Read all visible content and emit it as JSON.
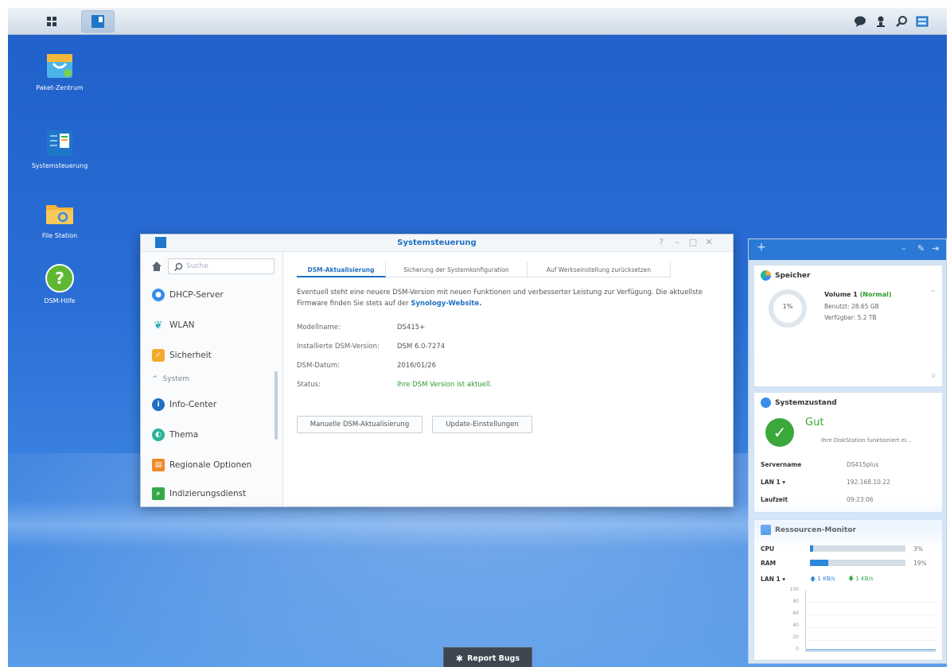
{
  "taskbar": {
    "right_icons": [
      "chat-icon",
      "user-icon",
      "search-icon",
      "widgets-icon"
    ]
  },
  "desktop": {
    "icons": [
      {
        "label": "Paket-Zentrum"
      },
      {
        "label": "Systemsteuerung"
      },
      {
        "label": "File Station"
      },
      {
        "label": "DSM-Hilfe"
      }
    ]
  },
  "window": {
    "title": "Systemsteuerung",
    "search_placeholder": "Suche",
    "sidebar": {
      "items": [
        "DHCP-Server",
        "WLAN",
        "Sicherheit"
      ],
      "section": "System",
      "system_items": [
        "Info-Center",
        "Thema",
        "Regionale Optionen",
        "Indizierungsdienst"
      ]
    },
    "tabs": [
      "DSM-Aktualisierung",
      "Sicherung der Systemkonfiguration",
      "Auf Werkseinstellung zurücksetzen"
    ],
    "description_1": "Eventuell steht eine neuere DSM-Version mit neuen Funktionen und verbesserter Leistung zur Verfügung. Die aktuellste Firmware finden Sie stets auf der",
    "description_link": "Synology-Website.",
    "info": [
      {
        "label": "Modellname:",
        "value": "DS415+"
      },
      {
        "label": "Installierte DSM-Version:",
        "value": "DSM 6.0-7274"
      },
      {
        "label": "DSM-Datum:",
        "value": "2016/01/26"
      },
      {
        "label": "Status:",
        "value": "Ihre DSM Version ist aktuell."
      }
    ],
    "buttons": {
      "manual": "Manuelle DSM-Aktualisierung",
      "settings": "Update-Einstellungen"
    }
  },
  "widgets": {
    "speicher": {
      "title": "Speicher",
      "percent": "1%",
      "volume": "Volume 1",
      "volume_status": "(Normal)",
      "used": "Benutzt: 28.65 GB",
      "available": "Verfügbar: 5.2 TB"
    },
    "systemzustand": {
      "title": "Systemzustand",
      "status": "Gut",
      "message": "Ihre DiskStation funktioniert ei...",
      "rows": [
        {
          "label": "Servername",
          "value": "DS415plus"
        },
        {
          "label": "LAN 1 ▾",
          "value": "192.168.10.22"
        },
        {
          "label": "Laufzeit",
          "value": "09:23:06"
        }
      ]
    },
    "ressourcen": {
      "title": "Ressourcen-Monitor",
      "cpu_label": "CPU",
      "cpu_value": "3%",
      "cpu_fraction": 0.03,
      "ram_label": "RAM",
      "ram_value": "19%",
      "ram_fraction": 0.19,
      "lan_label": "LAN 1 ▾",
      "lan_up": "1 KB/s",
      "lan_down": "1 KB/s",
      "y_ticks": [
        "100",
        "80",
        "60",
        "40",
        "20",
        "0"
      ]
    }
  },
  "report_bugs": "Report Bugs",
  "colors": {
    "accent": "#1f70c1",
    "ok": "#2e9a2e",
    "desktop": "#2a6fd6"
  }
}
